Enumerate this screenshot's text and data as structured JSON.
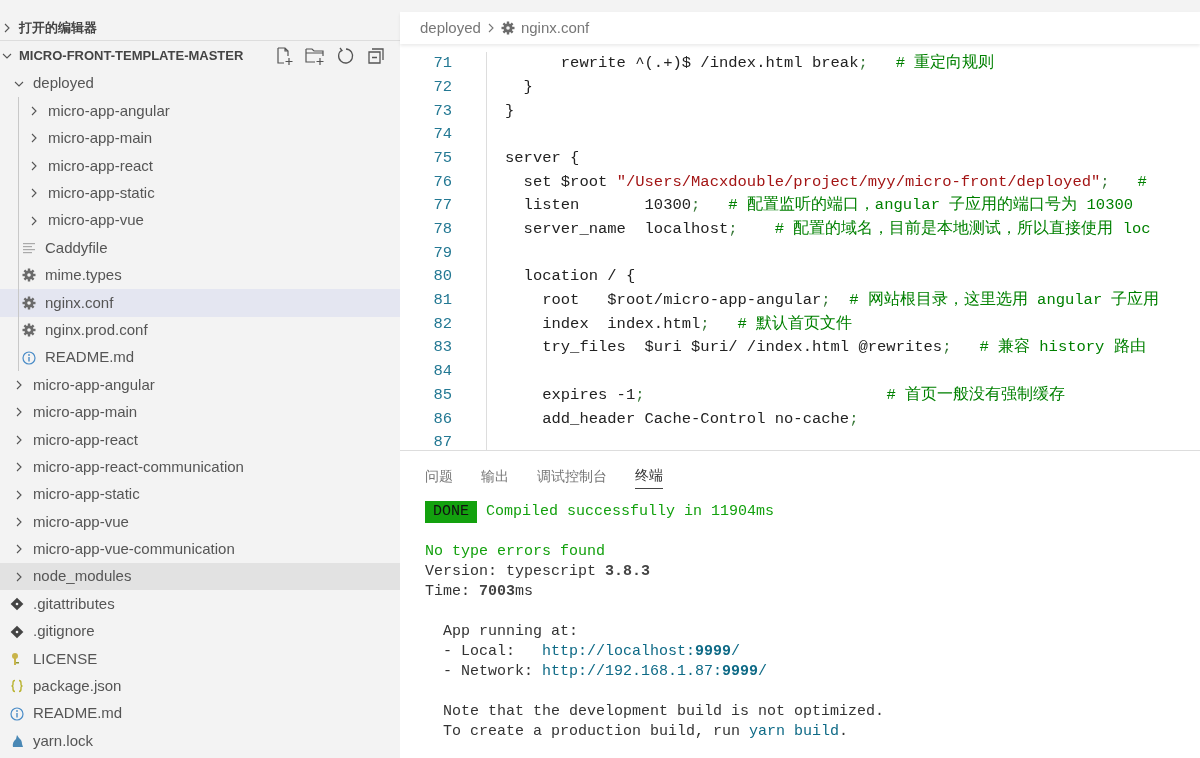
{
  "sidebar": {
    "open_editors": {
      "label": "打开的编辑器",
      "expanded": false
    },
    "root": {
      "label": "MICRO-FRONT-TEMPLATE-MASTER",
      "expanded": true
    },
    "tree": [
      {
        "label": "deployed",
        "kind": "folder",
        "expanded": true,
        "selected": false,
        "hovered": false,
        "children": [
          {
            "label": "micro-app-angular",
            "kind": "folder",
            "expanded": false,
            "selected": false,
            "hovered": false
          },
          {
            "label": "micro-app-main",
            "kind": "folder",
            "expanded": false,
            "selected": false,
            "hovered": false
          },
          {
            "label": "micro-app-react",
            "kind": "folder",
            "expanded": false,
            "selected": false,
            "hovered": false
          },
          {
            "label": "micro-app-static",
            "kind": "folder",
            "expanded": false,
            "selected": false,
            "hovered": false
          },
          {
            "label": "micro-app-vue",
            "kind": "folder",
            "expanded": false,
            "selected": false,
            "hovered": false
          },
          {
            "label": "Caddyfile",
            "kind": "text",
            "selected": false,
            "hovered": false
          },
          {
            "label": "mime.types",
            "kind": "config",
            "selected": false,
            "hovered": false
          },
          {
            "label": "nginx.conf",
            "kind": "config",
            "selected": true,
            "hovered": false
          },
          {
            "label": "nginx.prod.conf",
            "kind": "config",
            "selected": false,
            "hovered": false
          },
          {
            "label": "README.md",
            "kind": "readme",
            "selected": false,
            "hovered": false
          }
        ]
      },
      {
        "label": "micro-app-angular",
        "kind": "folder",
        "expanded": false,
        "selected": false,
        "hovered": false
      },
      {
        "label": "micro-app-main",
        "kind": "folder",
        "expanded": false,
        "selected": false,
        "hovered": false
      },
      {
        "label": "micro-app-react",
        "kind": "folder",
        "expanded": false,
        "selected": false,
        "hovered": false
      },
      {
        "label": "micro-app-react-communication",
        "kind": "folder",
        "expanded": false,
        "selected": false,
        "hovered": false
      },
      {
        "label": "micro-app-static",
        "kind": "folder",
        "expanded": false,
        "selected": false,
        "hovered": false
      },
      {
        "label": "micro-app-vue",
        "kind": "folder",
        "expanded": false,
        "selected": false,
        "hovered": false
      },
      {
        "label": "micro-app-vue-communication",
        "kind": "folder",
        "expanded": false,
        "selected": false,
        "hovered": false
      },
      {
        "label": "node_modules",
        "kind": "folder",
        "expanded": false,
        "selected": false,
        "hovered": true
      },
      {
        "label": ".gitattributes",
        "kind": "git",
        "selected": false,
        "hovered": false
      },
      {
        "label": ".gitignore",
        "kind": "git",
        "selected": false,
        "hovered": false
      },
      {
        "label": "LICENSE",
        "kind": "license",
        "selected": false,
        "hovered": false
      },
      {
        "label": "package.json",
        "kind": "json",
        "selected": false,
        "hovered": false
      },
      {
        "label": "README.md",
        "kind": "readme",
        "selected": false,
        "hovered": false
      },
      {
        "label": "yarn.lock",
        "kind": "yarn",
        "selected": false,
        "hovered": false
      }
    ]
  },
  "breadcrumb": [
    {
      "label": "deployed",
      "kind": "folder"
    },
    {
      "label": "nginx.conf",
      "kind": "config"
    }
  ],
  "editor": {
    "lines": [
      {
        "number": "71",
        "segments": [
          {
            "kind": "code",
            "text": "      rewrite ^(.+)$ /index.html break"
          },
          {
            "kind": "punct",
            "text": ";"
          },
          {
            "kind": "comment",
            "text": "   # 重定向规则"
          }
        ]
      },
      {
        "number": "72",
        "segments": [
          {
            "kind": "code",
            "text": "  }"
          }
        ]
      },
      {
        "number": "73",
        "segments": [
          {
            "kind": "code",
            "text": "}"
          }
        ]
      },
      {
        "number": "74"
      },
      {
        "number": "75",
        "segments": [
          {
            "kind": "code",
            "text": "server {"
          }
        ]
      },
      {
        "number": "76",
        "segments": [
          {
            "kind": "code",
            "text": "  set $root "
          },
          {
            "kind": "string",
            "text": "\"/Users/Macxdouble/project/myy/micro-front/deployed\""
          },
          {
            "kind": "punct",
            "text": ";"
          },
          {
            "kind": "comment",
            "text": "   #"
          }
        ]
      },
      {
        "number": "77",
        "segments": [
          {
            "kind": "code",
            "text": "  listen       10300"
          },
          {
            "kind": "punct",
            "text": ";"
          },
          {
            "kind": "comment",
            "text": "   # 配置监听的端口，angular 子应用的端口号为 10300"
          }
        ]
      },
      {
        "number": "78",
        "segments": [
          {
            "kind": "code",
            "text": "  server_name  localhost"
          },
          {
            "kind": "punct",
            "text": ";"
          },
          {
            "kind": "comment",
            "text": "    # 配置的域名，目前是本地测试，所以直接使用 loc"
          }
        ]
      },
      {
        "number": "79"
      },
      {
        "number": "80",
        "segments": [
          {
            "kind": "code",
            "text": "  location / {"
          }
        ]
      },
      {
        "number": "81",
        "segments": [
          {
            "kind": "code",
            "text": "    root   $root/micro-app-angular"
          },
          {
            "kind": "punct",
            "text": ";"
          },
          {
            "kind": "comment",
            "text": "  # 网站根目录，这里选用 angular 子应用"
          }
        ]
      },
      {
        "number": "82",
        "segments": [
          {
            "kind": "code",
            "text": "    index  index.html"
          },
          {
            "kind": "punct",
            "text": ";"
          },
          {
            "kind": "comment",
            "text": "   # 默认首页文件"
          }
        ]
      },
      {
        "number": "83",
        "segments": [
          {
            "kind": "code",
            "text": "    try_files  $uri $uri/ /index.html @rewrites"
          },
          {
            "kind": "punct",
            "text": ";"
          },
          {
            "kind": "comment",
            "text": "   # 兼容 history 路由"
          }
        ]
      },
      {
        "number": "84"
      },
      {
        "number": "85",
        "segments": [
          {
            "kind": "code",
            "text": "    expires -1"
          },
          {
            "kind": "punct",
            "text": ";"
          },
          {
            "kind": "comment",
            "text": "                          # 首页一般没有强制缓存"
          }
        ]
      },
      {
        "number": "86",
        "segments": [
          {
            "kind": "code",
            "text": "    add_header Cache-Control no-cache"
          },
          {
            "kind": "punct",
            "text": ";"
          }
        ]
      },
      {
        "number": "87"
      }
    ]
  },
  "panel": {
    "tabs": [
      {
        "label": "问题",
        "selected": false
      },
      {
        "label": "输出",
        "selected": false
      },
      {
        "label": "调试控制台",
        "selected": false
      },
      {
        "label": "终端",
        "selected": true
      }
    ],
    "terminal_blocks": [
      [
        [
          {
            "kind": "badge",
            "text": "DONE"
          },
          {
            "kind": "success",
            "text": " Compiled successfully in 11904ms"
          }
        ]
      ],
      [
        [
          {
            "kind": "success",
            "text": "No type errors found"
          }
        ],
        [
          {
            "kind": "plain",
            "text": "Version: typescript "
          },
          {
            "kind": "bold",
            "text": "3.8.3"
          }
        ],
        [
          {
            "kind": "plain",
            "text": "Time: "
          },
          {
            "kind": "bold",
            "text": "7003"
          },
          {
            "kind": "plain",
            "text": "ms"
          }
        ]
      ],
      [
        [
          {
            "kind": "plain",
            "text": "  App running at:"
          }
        ],
        [
          {
            "kind": "plain",
            "text": "  - Local:   "
          },
          {
            "kind": "link",
            "text": "http://localhost:"
          },
          {
            "kind": "link-bold",
            "text": "9999"
          },
          {
            "kind": "link",
            "text": "/"
          }
        ],
        [
          {
            "kind": "plain",
            "text": "  - Network: "
          },
          {
            "kind": "link",
            "text": "http://192.168.1.87:"
          },
          {
            "kind": "link-bold",
            "text": "9999"
          },
          {
            "kind": "link",
            "text": "/"
          }
        ]
      ],
      [
        [
          {
            "kind": "plain",
            "text": "  Note that the development build is not optimized."
          }
        ],
        [
          {
            "kind": "plain",
            "text": "  To create a production build, run "
          },
          {
            "kind": "link",
            "text": "yarn build"
          },
          {
            "kind": "plain",
            "text": "."
          }
        ]
      ]
    ]
  }
}
